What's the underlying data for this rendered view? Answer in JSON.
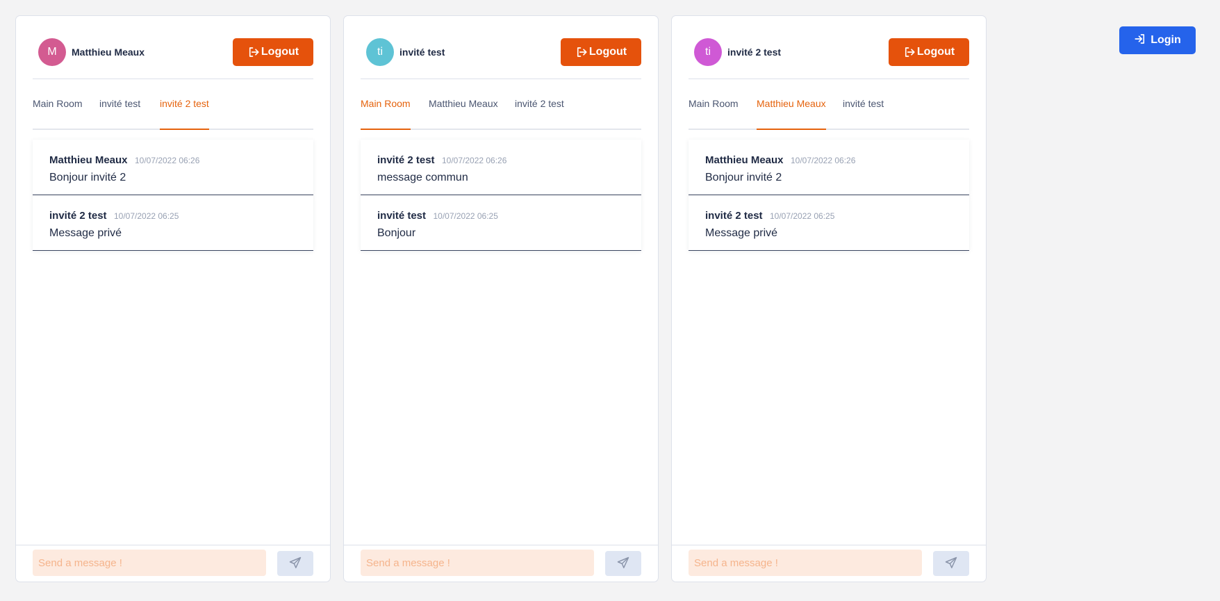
{
  "colors": {
    "accent": "#e5620c",
    "logout_button": "#e5520c",
    "login_button": "#2563eb",
    "input_background": "#fdeadf",
    "send_button": "#dfe6f3"
  },
  "icons": {
    "logout": "logout-icon",
    "login": "login-icon",
    "send": "send-icon"
  },
  "login_button": {
    "label": "Login"
  },
  "panels": [
    {
      "user": {
        "initials": "M",
        "name": "Matthieu Meaux",
        "avatar_color": "#d35b91"
      },
      "logout_label": "Logout",
      "tabs": [
        {
          "label": "Main Room",
          "active": false
        },
        {
          "label": "invité test",
          "active": false
        },
        {
          "label": "invité 2 test",
          "active": true
        }
      ],
      "messages": [
        {
          "author": "Matthieu Meaux",
          "time": "10/07/2022 06:26",
          "text": "Bonjour invité 2"
        },
        {
          "author": "invité 2 test",
          "time": "10/07/2022 06:25",
          "text": "Message privé"
        }
      ],
      "composer": {
        "placeholder": "Send a message !",
        "value": ""
      }
    },
    {
      "user": {
        "initials": "ti",
        "name": "invité test",
        "avatar_color": "#5ec3d5"
      },
      "logout_label": "Logout",
      "tabs": [
        {
          "label": "Main Room",
          "active": true
        },
        {
          "label": "Matthieu Meaux",
          "active": false
        },
        {
          "label": "invité 2 test",
          "active": false
        }
      ],
      "messages": [
        {
          "author": "invité 2 test",
          "time": "10/07/2022 06:26",
          "text": "message commun"
        },
        {
          "author": "invité test",
          "time": "10/07/2022 06:25",
          "text": "Bonjour"
        }
      ],
      "composer": {
        "placeholder": "Send a message !",
        "value": ""
      }
    },
    {
      "user": {
        "initials": "ti",
        "name": "invité 2 test",
        "avatar_color": "#cf59d5"
      },
      "logout_label": "Logout",
      "tabs": [
        {
          "label": "Main Room",
          "active": false
        },
        {
          "label": "Matthieu Meaux",
          "active": true
        },
        {
          "label": "invité test",
          "active": false
        }
      ],
      "messages": [
        {
          "author": "Matthieu Meaux",
          "time": "10/07/2022 06:26",
          "text": "Bonjour invité 2"
        },
        {
          "author": "invité 2 test",
          "time": "10/07/2022 06:25",
          "text": "Message privé"
        }
      ],
      "composer": {
        "placeholder": "Send a message !",
        "value": ""
      }
    }
  ]
}
